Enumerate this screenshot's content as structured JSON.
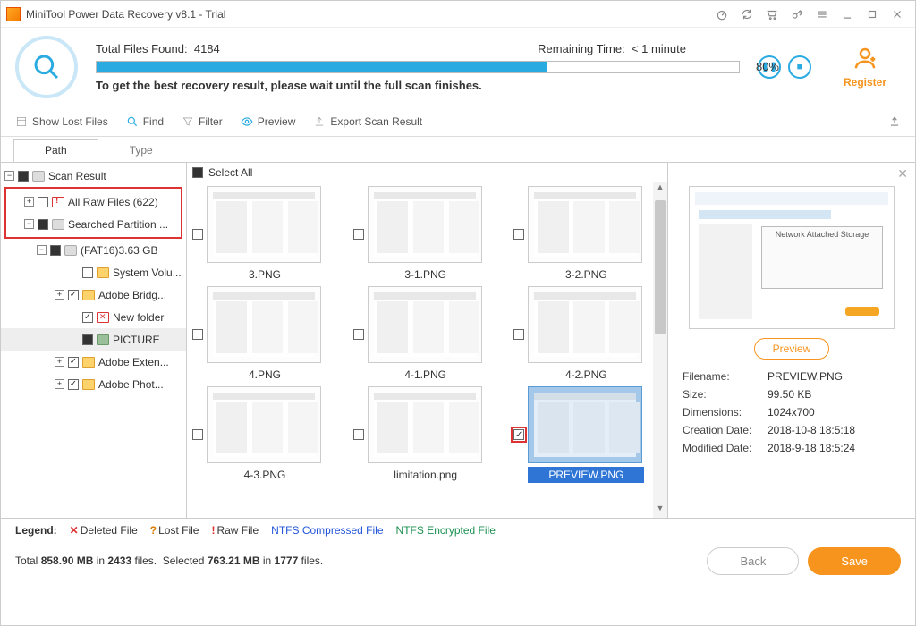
{
  "titlebar": {
    "title": "MiniTool Power Data Recovery v8.1 - Trial"
  },
  "scan": {
    "found_label": "Total Files Found:",
    "found_value": "4184",
    "remaining_label": "Remaining Time:",
    "remaining_value": "< 1 minute",
    "percent": "80%",
    "message": "To get the best recovery result, please wait until the full scan finishes."
  },
  "register": {
    "label": "Register"
  },
  "toolbar": {
    "show_lost": "Show Lost Files",
    "find": "Find",
    "filter": "Filter",
    "preview": "Preview",
    "export": "Export Scan Result"
  },
  "tabs": {
    "path": "Path",
    "type": "Type"
  },
  "tree": {
    "root": "Scan Result",
    "raw": "All Raw Files (622)",
    "searched": "Searched Partition ...",
    "fat": "(FAT16)3.63 GB",
    "sysvol": "System Volu...",
    "bridge": "Adobe Bridg...",
    "newfolder": "New folder",
    "picture": "PICTURE",
    "exten": "Adobe Exten...",
    "phot": "Adobe Phot..."
  },
  "grid": {
    "select_all": "Select All",
    "items": [
      "3.PNG",
      "3-1.PNG",
      "3-2.PNG",
      "4.PNG",
      "4-1.PNG",
      "4-2.PNG",
      "4-3.PNG",
      "limitation.png",
      "PREVIEW.PNG"
    ]
  },
  "preview": {
    "btn": "Preview",
    "nas_label": "Network Attached Storage",
    "meta": {
      "filename_k": "Filename:",
      "filename_v": "PREVIEW.PNG",
      "size_k": "Size:",
      "size_v": "99.50 KB",
      "dim_k": "Dimensions:",
      "dim_v": "1024x700",
      "cdate_k": "Creation Date:",
      "cdate_v": "2018-10-8 18:5:18",
      "mdate_k": "Modified Date:",
      "mdate_v": "2018-9-18 18:5:24"
    }
  },
  "legend": {
    "label": "Legend:",
    "deleted": "Deleted File",
    "lost": "Lost File",
    "raw": "Raw File",
    "ntfs_c": "NTFS Compressed File",
    "ntfs_e": "NTFS Encrypted File"
  },
  "status": {
    "line": "Total 858.90 MB in 2433 files.  Selected 763.21 MB in 1777 files.",
    "back": "Back",
    "save": "Save"
  }
}
